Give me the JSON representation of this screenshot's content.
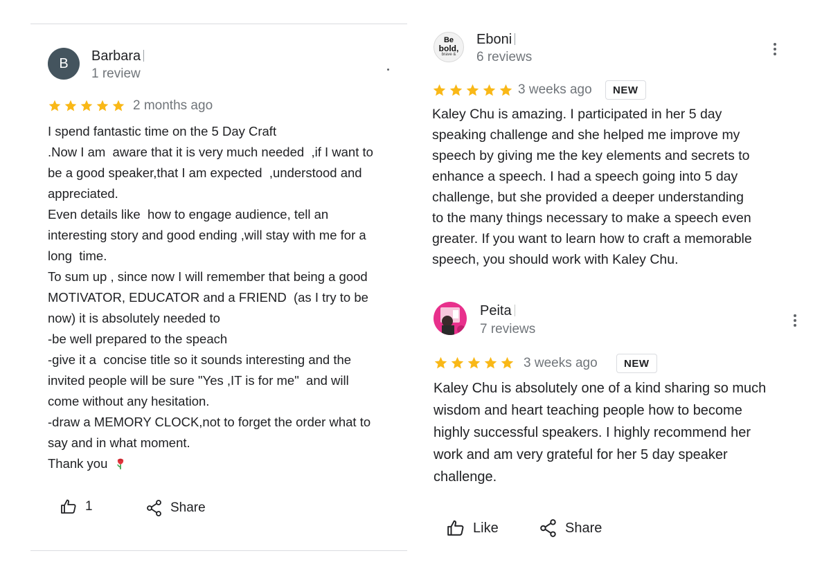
{
  "left_review": {
    "avatar_letter": "B",
    "name": "Barbara",
    "review_count": "1 review",
    "stars": 5,
    "date": "2 months ago",
    "text_lines": [
      "I spend fantastic time on the 5 Day Craft",
      ".Now I am  aware that it is very much needed  ,if I want to",
      "be a good speaker,that I am expected  ,understood and",
      "appreciated.",
      "Even details like  how to engage audience, tell an",
      "interesting story and good ending ,will stay with me for a",
      "long  time.",
      "To sum up , since now I will remember that being a good",
      "MOTIVATOR, EDUCATOR and a FRIEND  (as I try to be",
      "now) it is absolutely needed to",
      "-be well prepared to the speach",
      "-give it a  concise title so it sounds interesting and the",
      "invited people will be sure \"Yes ,IT is for me\"  and will",
      "come without any hesitation.",
      "-draw a MEMORY CLOCK,not to forget the order what to",
      "say and in what moment.",
      "Thank you"
    ],
    "like_label": "1",
    "share_label": "Share"
  },
  "right_reviews": [
    {
      "avatar_text": [
        "Be",
        "bold,",
        "brave &"
      ],
      "name": "Eboni",
      "review_count": "6 reviews",
      "stars": 5,
      "date": "3 weeks ago",
      "badge": "NEW",
      "text_lines": [
        "Kaley Chu is amazing. I participated in her 5 day",
        "speaking challenge and she helped me improve my",
        "speech by giving me the key elements and secrets to",
        "enhance a speech. I had a speech going into 5 day",
        "challenge, but she provided a deeper understanding",
        "to the many things necessary to make a speech even",
        "greater. If you want to learn how to craft a memorable",
        "speech, you should work with Kaley Chu."
      ]
    },
    {
      "name": "Peita",
      "review_count": "7 reviews",
      "stars": 5,
      "date": "3 weeks ago",
      "badge": "NEW",
      "text_lines": [
        "Kaley Chu is absolutely one of a kind sharing so much",
        "wisdom and heart teaching people how to become",
        "highly successful speakers. I highly recommend her",
        "work and am very grateful for her 5 day speaker",
        "challenge."
      ],
      "like_label": "Like",
      "share_label": "Share"
    }
  ],
  "colors": {
    "star": "#f9b817",
    "avatar_letter_bg": "#44545e",
    "divider": "#dadce0",
    "muted_text": "#70757a"
  },
  "icons": {
    "star": "star-icon",
    "thumbs_up": "thumbs-up-icon",
    "share": "share-icon",
    "more": "more-vert-icon",
    "rose": "rose-emoji-icon"
  }
}
